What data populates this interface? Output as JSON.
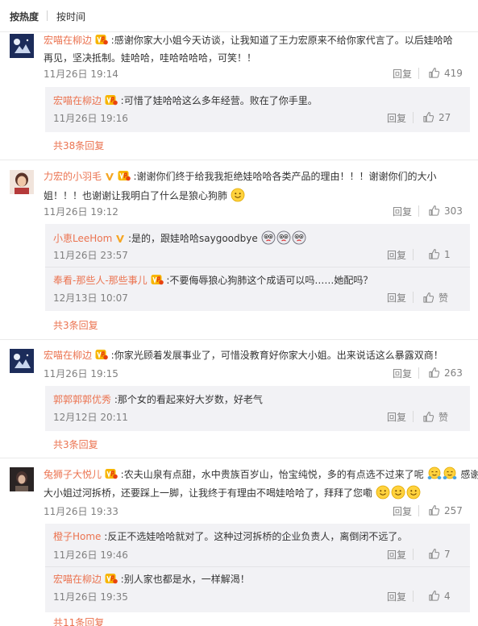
{
  "sort_tabs": [
    "按热度",
    "按时间"
  ],
  "comments": [
    {
      "user": "宏喵在柳边",
      "text_line1": ":感谢你家大小姐今天访谈，让我知道了王力宏原来不给你家代言了。以后娃哈哈",
      "text_line2": "再见，坚决抵制。娃哈哈，哇哈哈哈哈，可笑！！",
      "time": "11月26日 19:14",
      "reply_label": "回复",
      "likes": "419",
      "replies": [
        {
          "user": "宏喵在柳边",
          "text": ":可惜了娃哈哈这么多年经营。败在了你手里。",
          "time": "11月26日 19:16",
          "reply_label": "回复",
          "likes": "27"
        }
      ],
      "more": "共38条回复"
    },
    {
      "user": "力宏的小羽毛",
      "text_line1": ":谢谢你们终于给我我拒绝娃哈哈各类产品的理由！！！谢谢你们的大小",
      "text_line2": "姐！！！也谢谢让我明白了什么是狼心狗肺",
      "time": "11月26日 19:12",
      "reply_label": "回复",
      "likes": "303",
      "replies": [
        {
          "user": "小恵LeeHom",
          "text": ":是的，跟娃哈哈saygoodbye",
          "time": "11月26日 23:57",
          "reply_label": "回复",
          "likes": "1"
        },
        {
          "user": "奉看-那些人-那些事儿",
          "text": ":不要侮辱狼心狗肺这个成语可以吗……她配吗？",
          "time": "12月13日 10:07",
          "reply_label": "回复",
          "likes": "赞"
        }
      ],
      "more": "共3条回复"
    },
    {
      "user": "宏喵在柳边",
      "text_line1": ":你家光顾着发展事业了，可惜没教育好你家大小姐。出来说话这么暴露双商！",
      "time": "11月26日 19:15",
      "reply_label": "回复",
      "likes": "263",
      "replies": [
        {
          "user": "郭郭郭郭优秀",
          "text": ":那个女的看起来好大岁数，好老气",
          "time": "12月12日 20:11",
          "reply_label": "回复",
          "likes": "赞"
        }
      ],
      "more": "共3条回复"
    },
    {
      "user": "兔狮子大悦儿",
      "text_line1": ":农夫山泉有点甜，水中贵族百岁山，怡宝纯悦，多的有点选不过来了呢",
      "text_line1b": "感谢",
      "text_line2": "大小姐过河拆桥，还要踩上一脚，让我终于有理由不喝娃哈哈了，拜拜了您嘞",
      "time": "11月26日 19:33",
      "reply_label": "回复",
      "likes": "257",
      "replies": [
        {
          "user": "橙子Home",
          "text": ":反正不选娃哈哈就对了。这种过河拆桥的企业负责人，离倒闭不远了。",
          "time": "11月26日 19:46",
          "reply_label": "回复",
          "likes": "7"
        },
        {
          "user": "宏喵在柳边",
          "text": ":别人家也都是水，一样解渴！",
          "time": "11月26日 19:35",
          "reply_label": "回复",
          "likes": "4"
        }
      ],
      "more": "共11条回复"
    }
  ],
  "icons": {
    "like": "thumbs-up-icon",
    "verified_badge": "verified-v-icon",
    "member_badge": "member-badge-icon",
    "smile_emoji": "smile-emoji-icon",
    "cry_emoji": "cry-emoji-icon",
    "hug_emoji": "hug-emoji-icon"
  },
  "colors": {
    "username": "#eb7350",
    "meta": "#808080",
    "reply_bg": "#f2f2f5",
    "verified": "#f5a623"
  }
}
